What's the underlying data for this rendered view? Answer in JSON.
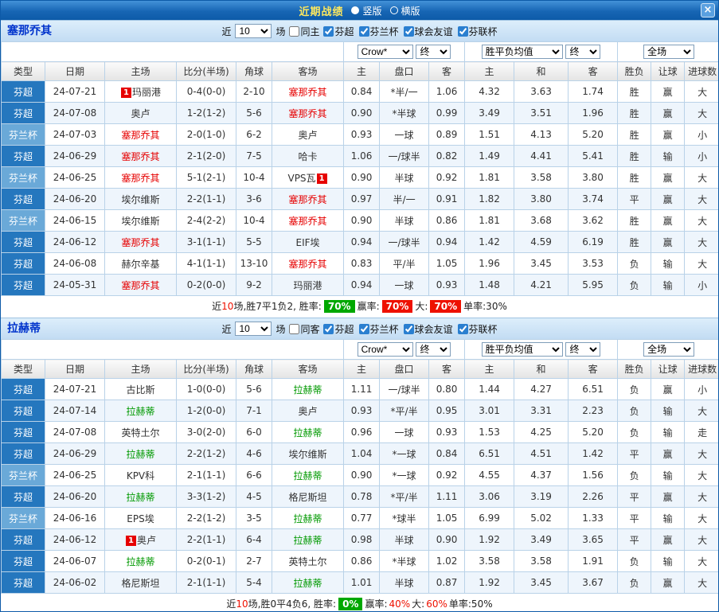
{
  "titlebar": {
    "title": "近期战绩",
    "radios": [
      {
        "label": "竖版",
        "selected": true
      },
      {
        "label": "横版",
        "selected": false
      }
    ],
    "close": "×"
  },
  "table": {
    "columns": [
      "类型",
      "日期",
      "主场",
      "比分(半场)",
      "角球",
      "客场",
      "主",
      "盘口",
      "客",
      "主",
      "和",
      "客",
      "胜负",
      "让球",
      "进球数"
    ],
    "filters": {
      "bookmaker": "Crow*",
      "bookmaker_stage": "终",
      "avg_metric": "胜平负均值",
      "avg_stage": "终",
      "scope": "全场"
    }
  },
  "colors": {
    "accent_blue": "#0d5aa8",
    "league_super_bg": "#2577be",
    "league_cup_bg": "#6aa9d8",
    "win_red": "#e60000",
    "lose_green": "#009933",
    "draw_blue": "#2244cc",
    "section1_focus_team": "#e60000",
    "section2_focus_team": "#009900"
  },
  "sections": [
    {
      "team": "塞那乔其",
      "team_color": "red",
      "controls": {
        "near": "近",
        "count": "10",
        "matches": "场",
        "same_label": "同主",
        "same_checked": false,
        "leagues": [
          {
            "label": "芬超",
            "checked": true
          },
          {
            "label": "芬兰杯",
            "checked": true
          },
          {
            "label": "球会友谊",
            "checked": true
          },
          {
            "label": "芬联杯",
            "checked": true
          }
        ]
      },
      "rows": [
        {
          "type": "芬超",
          "date": "24-07-21",
          "home": "玛丽港",
          "home_badge": "1",
          "home_badge_side": "left",
          "home_focus": false,
          "score": "0-4(0-0)",
          "corners": "2-10",
          "away": "塞那乔其",
          "away_focus": true,
          "odds_home": "0.84",
          "handicap": "*半/一",
          "odds_away": "1.06",
          "avg_home": "4.32",
          "avg_draw": "3.63",
          "avg_away": "1.74",
          "result": "胜",
          "handicap_result": "赢",
          "goals": "大"
        },
        {
          "type": "芬超",
          "date": "24-07-08",
          "home": "奥卢",
          "home_focus": false,
          "score": "1-2(1-2)",
          "corners": "5-6",
          "away": "塞那乔其",
          "away_focus": true,
          "odds_home": "0.90",
          "handicap": "*半球",
          "odds_away": "0.99",
          "avg_home": "3.49",
          "avg_draw": "3.51",
          "avg_away": "1.96",
          "result": "胜",
          "handicap_result": "赢",
          "goals": "大"
        },
        {
          "type": "芬兰杯",
          "date": "24-07-03",
          "home": "塞那乔其",
          "home_focus": true,
          "score": "2-0(1-0)",
          "corners": "6-2",
          "away": "奥卢",
          "away_focus": false,
          "odds_home": "0.93",
          "handicap": "一球",
          "odds_away": "0.89",
          "avg_home": "1.51",
          "avg_draw": "4.13",
          "avg_away": "5.20",
          "result": "胜",
          "handicap_result": "赢",
          "goals": "小"
        },
        {
          "type": "芬超",
          "date": "24-06-29",
          "home": "塞那乔其",
          "home_focus": true,
          "score": "2-1(2-0)",
          "corners": "7-5",
          "away": "哈卡",
          "away_focus": false,
          "odds_home": "1.06",
          "handicap": "一/球半",
          "odds_away": "0.82",
          "avg_home": "1.49",
          "avg_draw": "4.41",
          "avg_away": "5.41",
          "result": "胜",
          "handicap_result": "输",
          "goals": "小"
        },
        {
          "type": "芬兰杯",
          "date": "24-06-25",
          "home": "塞那乔其",
          "home_focus": true,
          "score": "5-1(2-1)",
          "corners": "10-4",
          "away": "VPS瓦",
          "away_badge": "1",
          "away_badge_side": "right",
          "away_focus": false,
          "odds_home": "0.90",
          "handicap": "半球",
          "odds_away": "0.92",
          "avg_home": "1.81",
          "avg_draw": "3.58",
          "avg_away": "3.80",
          "result": "胜",
          "handicap_result": "赢",
          "goals": "大"
        },
        {
          "type": "芬超",
          "date": "24-06-20",
          "home": "埃尔维斯",
          "home_focus": false,
          "score": "2-2(1-1)",
          "corners": "3-6",
          "away": "塞那乔其",
          "away_focus": true,
          "odds_home": "0.97",
          "handicap": "半/一",
          "odds_away": "0.91",
          "avg_home": "1.82",
          "avg_draw": "3.80",
          "avg_away": "3.74",
          "result": "平",
          "handicap_result": "赢",
          "goals": "大"
        },
        {
          "type": "芬兰杯",
          "date": "24-06-15",
          "home": "埃尔维斯",
          "home_focus": false,
          "score": "2-4(2-2)",
          "corners": "10-4",
          "away": "塞那乔其",
          "away_focus": true,
          "odds_home": "0.90",
          "handicap": "半球",
          "odds_away": "0.86",
          "avg_home": "1.81",
          "avg_draw": "3.68",
          "avg_away": "3.62",
          "result": "胜",
          "handicap_result": "赢",
          "goals": "大"
        },
        {
          "type": "芬超",
          "date": "24-06-12",
          "home": "塞那乔其",
          "home_focus": true,
          "score": "3-1(1-1)",
          "corners": "5-5",
          "away": "EIF埃",
          "away_focus": false,
          "odds_home": "0.94",
          "handicap": "一/球半",
          "odds_away": "0.94",
          "avg_home": "1.42",
          "avg_draw": "4.59",
          "avg_away": "6.19",
          "result": "胜",
          "handicap_result": "赢",
          "goals": "大"
        },
        {
          "type": "芬超",
          "date": "24-06-08",
          "home": "赫尔辛基",
          "home_focus": false,
          "score": "4-1(1-1)",
          "corners": "13-10",
          "away": "塞那乔其",
          "away_focus": true,
          "odds_home": "0.83",
          "handicap": "平/半",
          "odds_away": "1.05",
          "avg_home": "1.96",
          "avg_draw": "3.45",
          "avg_away": "3.53",
          "result": "负",
          "handicap_result": "输",
          "goals": "大"
        },
        {
          "type": "芬超",
          "date": "24-05-31",
          "home": "塞那乔其",
          "home_focus": true,
          "score": "0-2(0-0)",
          "corners": "9-2",
          "away": "玛丽港",
          "away_focus": false,
          "odds_home": "0.94",
          "handicap": "一球",
          "odds_away": "0.93",
          "avg_home": "1.48",
          "avg_draw": "4.21",
          "avg_away": "5.95",
          "result": "负",
          "handicap_result": "输",
          "goals": "小"
        }
      ],
      "summary": [
        {
          "text": "近",
          "style": "plain"
        },
        {
          "text": "10",
          "style": "red-num"
        },
        {
          "text": "场,胜7平1负2, 胜率:",
          "style": "plain"
        },
        {
          "text": "70%",
          "style": "green-bg"
        },
        {
          "text": "赢率:",
          "style": "plain"
        },
        {
          "text": "70%",
          "style": "red-bg"
        },
        {
          "text": "大:",
          "style": "plain"
        },
        {
          "text": "70%",
          "style": "red-bg"
        },
        {
          "text": "单率:30%",
          "style": "plain"
        }
      ]
    },
    {
      "team": "拉赫蒂",
      "team_color": "green",
      "controls": {
        "near": "近",
        "count": "10",
        "matches": "场",
        "same_label": "同客",
        "same_checked": false,
        "leagues": [
          {
            "label": "芬超",
            "checked": true
          },
          {
            "label": "芬兰杯",
            "checked": true
          },
          {
            "label": "球会友谊",
            "checked": true
          },
          {
            "label": "芬联杯",
            "checked": true
          }
        ]
      },
      "rows": [
        {
          "type": "芬超",
          "date": "24-07-21",
          "home": "古比斯",
          "home_focus": false,
          "score": "1-0(0-0)",
          "corners": "5-6",
          "away": "拉赫蒂",
          "away_focus": true,
          "odds_home": "1.11",
          "handicap": "一/球半",
          "odds_away": "0.80",
          "avg_home": "1.44",
          "avg_draw": "4.27",
          "avg_away": "6.51",
          "result": "负",
          "handicap_result": "赢",
          "goals": "小"
        },
        {
          "type": "芬超",
          "date": "24-07-14",
          "home": "拉赫蒂",
          "home_focus": true,
          "score": "1-2(0-0)",
          "corners": "7-1",
          "away": "奥卢",
          "away_focus": false,
          "odds_home": "0.93",
          "handicap": "*平/半",
          "odds_away": "0.95",
          "avg_home": "3.01",
          "avg_draw": "3.31",
          "avg_away": "2.23",
          "result": "负",
          "handicap_result": "输",
          "goals": "大"
        },
        {
          "type": "芬超",
          "date": "24-07-08",
          "home": "英特土尔",
          "home_focus": false,
          "score": "3-0(2-0)",
          "corners": "6-0",
          "away": "拉赫蒂",
          "away_focus": true,
          "odds_home": "0.96",
          "handicap": "一球",
          "odds_away": "0.93",
          "avg_home": "1.53",
          "avg_draw": "4.25",
          "avg_away": "5.20",
          "result": "负",
          "handicap_result": "输",
          "goals": "走"
        },
        {
          "type": "芬超",
          "date": "24-06-29",
          "home": "拉赫蒂",
          "home_focus": true,
          "score": "2-2(1-2)",
          "corners": "4-6",
          "away": "埃尔维斯",
          "away_focus": false,
          "odds_home": "1.04",
          "handicap": "*一球",
          "odds_away": "0.84",
          "avg_home": "6.51",
          "avg_draw": "4.51",
          "avg_away": "1.42",
          "result": "平",
          "handicap_result": "赢",
          "goals": "大"
        },
        {
          "type": "芬兰杯",
          "date": "24-06-25",
          "home": "KPV科",
          "home_focus": false,
          "score": "2-1(1-1)",
          "corners": "6-6",
          "away": "拉赫蒂",
          "away_focus": true,
          "odds_home": "0.90",
          "handicap": "*一球",
          "odds_away": "0.92",
          "avg_home": "4.55",
          "avg_draw": "4.37",
          "avg_away": "1.56",
          "result": "负",
          "handicap_result": "输",
          "goals": "大"
        },
        {
          "type": "芬超",
          "date": "24-06-20",
          "home": "拉赫蒂",
          "home_focus": true,
          "score": "3-3(1-2)",
          "corners": "4-5",
          "away": "格尼斯坦",
          "away_focus": false,
          "odds_home": "0.78",
          "handicap": "*平/半",
          "odds_away": "1.11",
          "avg_home": "3.06",
          "avg_draw": "3.19",
          "avg_away": "2.26",
          "result": "平",
          "handicap_result": "赢",
          "goals": "大"
        },
        {
          "type": "芬兰杯",
          "date": "24-06-16",
          "home": "EPS埃",
          "home_focus": false,
          "score": "2-2(1-2)",
          "corners": "3-5",
          "away": "拉赫蒂",
          "away_focus": true,
          "odds_home": "0.77",
          "handicap": "*球半",
          "odds_away": "1.05",
          "avg_home": "6.99",
          "avg_draw": "5.02",
          "avg_away": "1.33",
          "result": "平",
          "handicap_result": "输",
          "goals": "大"
        },
        {
          "type": "芬超",
          "date": "24-06-12",
          "home": "奥卢",
          "home_badge": "1",
          "home_badge_side": "left",
          "home_focus": false,
          "score": "2-2(1-1)",
          "corners": "6-4",
          "away": "拉赫蒂",
          "away_focus": true,
          "odds_home": "0.98",
          "handicap": "半球",
          "odds_away": "0.90",
          "avg_home": "1.92",
          "avg_draw": "3.49",
          "avg_away": "3.65",
          "result": "平",
          "handicap_result": "赢",
          "goals": "大"
        },
        {
          "type": "芬超",
          "date": "24-06-07",
          "home": "拉赫蒂",
          "home_focus": true,
          "score": "0-2(0-1)",
          "corners": "2-7",
          "away": "英特土尔",
          "away_focus": false,
          "odds_home": "0.86",
          "handicap": "*半球",
          "odds_away": "1.02",
          "avg_home": "3.58",
          "avg_draw": "3.58",
          "avg_away": "1.91",
          "result": "负",
          "handicap_result": "输",
          "goals": "大"
        },
        {
          "type": "芬超",
          "date": "24-06-02",
          "home": "格尼斯坦",
          "home_focus": false,
          "score": "2-1(1-1)",
          "corners": "5-4",
          "away": "拉赫蒂",
          "away_focus": true,
          "odds_home": "1.01",
          "handicap": "半球",
          "odds_away": "0.87",
          "avg_home": "1.92",
          "avg_draw": "3.45",
          "avg_away": "3.67",
          "result": "负",
          "handicap_result": "赢",
          "goals": "大"
        }
      ],
      "summary": [
        {
          "text": "近",
          "style": "plain"
        },
        {
          "text": "10",
          "style": "red-num"
        },
        {
          "text": "场,胜0平4负6, 胜率:",
          "style": "plain"
        },
        {
          "text": "0%",
          "style": "green-bg"
        },
        {
          "text": "赢率:",
          "style": "plain"
        },
        {
          "text": "40%",
          "style": "red-text"
        },
        {
          "text": "大:",
          "style": "plain"
        },
        {
          "text": "60%",
          "style": "red-text"
        },
        {
          "text": "单率:50%",
          "style": "plain"
        }
      ]
    }
  ]
}
